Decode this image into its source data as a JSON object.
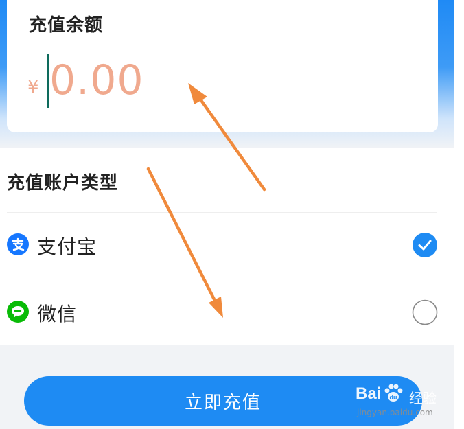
{
  "balance": {
    "title": "充值余额",
    "currency_symbol": "¥",
    "amount": "0.00"
  },
  "account_type": {
    "title": "充值账户类型",
    "options": [
      {
        "label": "支付宝",
        "icon": "alipay-icon",
        "selected": true
      },
      {
        "label": "微信",
        "icon": "wechat-icon",
        "selected": false
      }
    ]
  },
  "submit": {
    "label": "立即充值"
  },
  "watermark": {
    "brand": "Bai",
    "brand_cn": "经验",
    "url": "jingyan.baidu.com"
  },
  "colors": {
    "primary_blue": "#1e8bf3",
    "amount_text": "#f0a98e",
    "annotation_arrow": "#f08a3c",
    "alipay": "#1677ff",
    "wechat": "#09bb07"
  }
}
